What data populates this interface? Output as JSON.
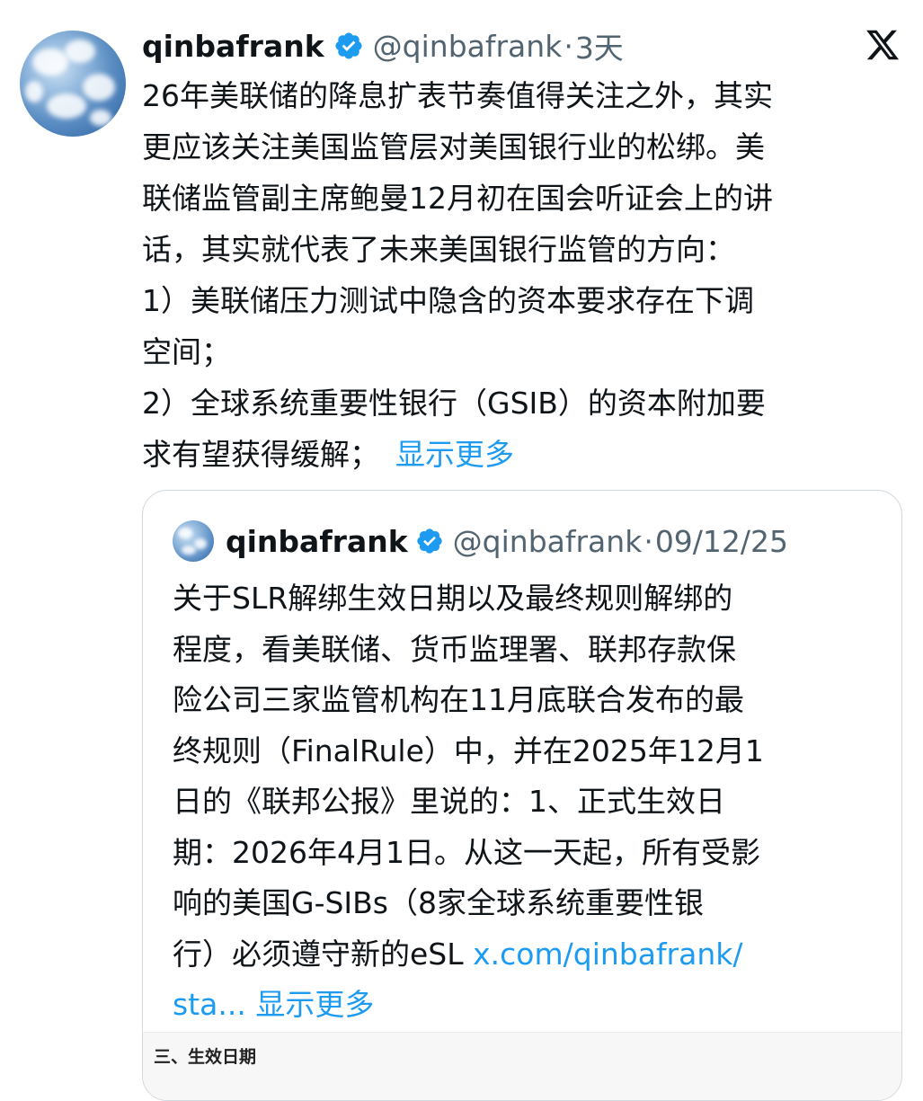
{
  "tweet": {
    "author": {
      "display_name": "qinbafrank",
      "handle": "@qinbafrank",
      "separator": "·",
      "time": "3天"
    },
    "lines": [
      "26年美联储的降息扩表节奏值得关注之外，其实",
      "更应该关注美国监管层对美国银行业的松绑。美",
      "联储监管副主席鲍曼12月初在国会听证会上的讲",
      "话，其实就代表了未来美国银行监管的方向：",
      "1）美联储压力测试中隐含的资本要求存在下调",
      "空间；",
      "2）全球系统重要性银行（GSIB）的资本附加要",
      "求有望获得缓解；"
    ],
    "show_more": "显示更多",
    "icons": {
      "verified": "verified-badge-icon",
      "platform": "x-logo-icon"
    },
    "colors": {
      "link": "#1d9bf0",
      "secondary": "#536471",
      "text": "#0f1419",
      "border": "#cfd9de"
    }
  },
  "quote": {
    "author": {
      "display_name": "qinbafrank",
      "handle": "@qinbafrank",
      "separator": "·",
      "time": "09/12/25"
    },
    "lines": [
      "关于SLR解绑生效日期以及最终规则解绑的",
      "程度，看美联储、货币监理署、联邦存款保",
      "险公司三家监管机构在11月底联合发布的最",
      "终规则（FinalRule）中，并在2025年12月1",
      "日的《联邦公报》里说的：1、正式生效日",
      "期：2026年4月1日。从这一天起，所有受影",
      "响的美国G-SIBs（8家全球系统重要性银"
    ],
    "last_line_text": "行）必须遵守新的eSL ",
    "link_text": "x.com/qinbafrank/",
    "link_tail": "sta...",
    "show_more": "显示更多",
    "image_caption": "三、生效日期"
  }
}
